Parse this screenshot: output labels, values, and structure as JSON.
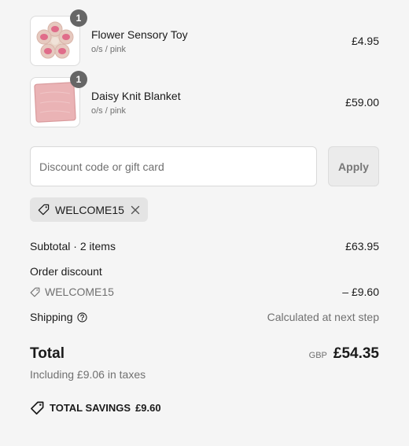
{
  "line_items": [
    {
      "name": "Flower Sensory Toy",
      "variant": "o/s / pink",
      "price": "£4.95",
      "quantity": "1",
      "image": "flower-sensory-toy-image"
    },
    {
      "name": "Daisy Knit Blanket",
      "variant": "o/s / pink",
      "price": "£59.00",
      "quantity": "1",
      "image": "pink-knit-blanket-image"
    }
  ],
  "discount": {
    "placeholder": "Discount code or gift card",
    "value": "",
    "apply_label": "Apply",
    "applied_code": "WELCOME15"
  },
  "summary": {
    "subtotal_label": "Subtotal · 2 items",
    "subtotal_value": "£63.95",
    "order_discount_label": "Order discount",
    "discount_code": "WELCOME15",
    "discount_value": "– £9.60",
    "shipping_label": "Shipping",
    "shipping_value": "Calculated at next step",
    "total_label": "Total",
    "currency": "GBP",
    "total_value": "£54.35",
    "tax_note": "Including £9.06 in taxes",
    "savings_label": "TOTAL SAVINGS",
    "savings_value": "£9.60"
  }
}
